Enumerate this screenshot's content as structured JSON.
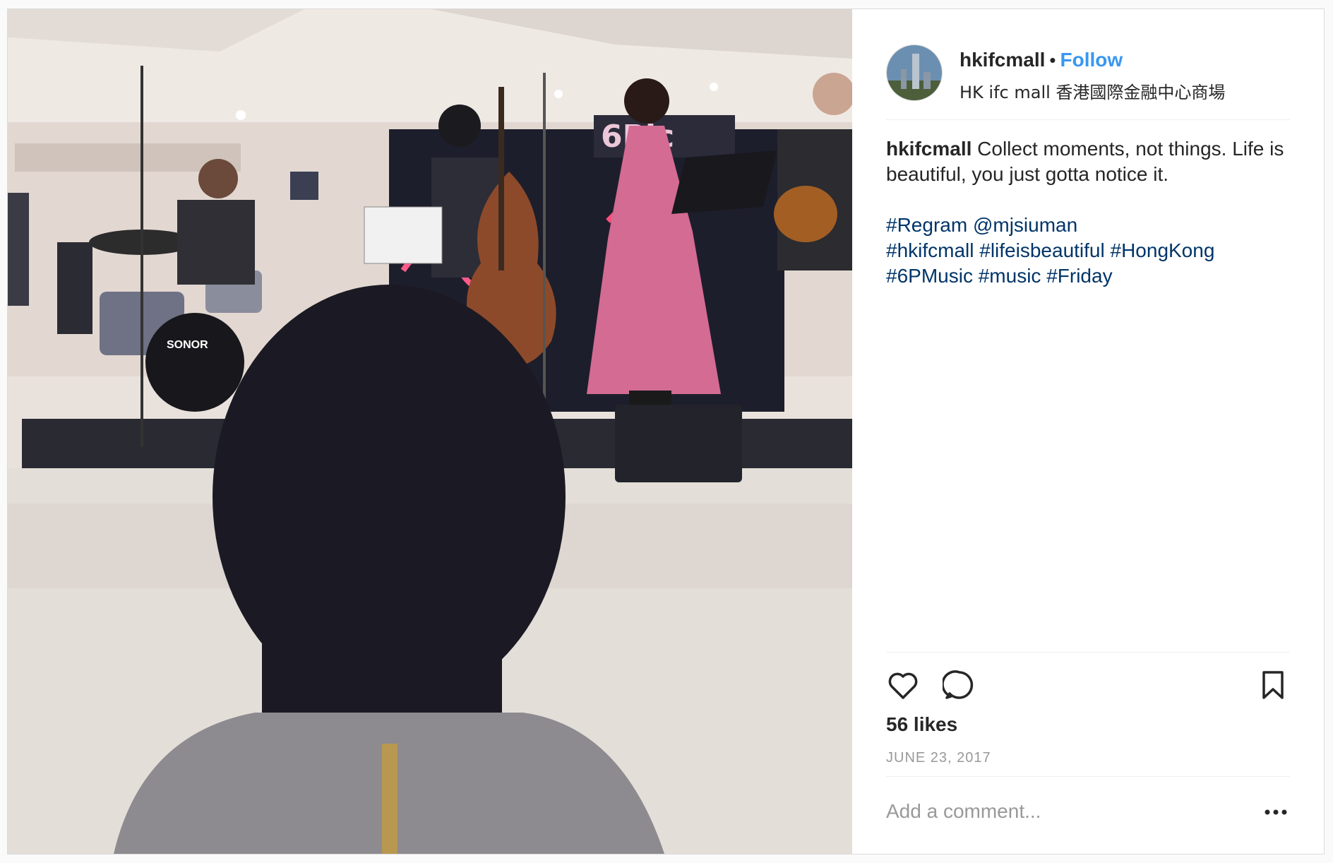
{
  "post": {
    "username": "hkifcmall",
    "dot": "•",
    "follow_label": "Follow",
    "location": "HK ifc mall 香港國際金融中心商場",
    "caption_text": "Collect moments, not things. Life is beautiful, you just gotta notice it.",
    "hashtags_line1": [
      "#Regram",
      "@mjsiuman"
    ],
    "hashtags_line2": [
      "#hkifcmall",
      "#lifeisbeautiful",
      "#HongKong"
    ],
    "hashtags_line3": [
      "#6PMusic",
      "#music",
      "#Friday"
    ],
    "likes": "56 likes",
    "date": "JUNE 23, 2017",
    "comment_placeholder": "Add a comment...",
    "image_text": "SONOR"
  },
  "colors": {
    "accent": "#3897f0",
    "hashtag": "#003569",
    "text": "#262626",
    "muted": "#999999"
  },
  "icons": [
    "heart-icon",
    "comment-icon",
    "bookmark-icon",
    "more-icon"
  ]
}
